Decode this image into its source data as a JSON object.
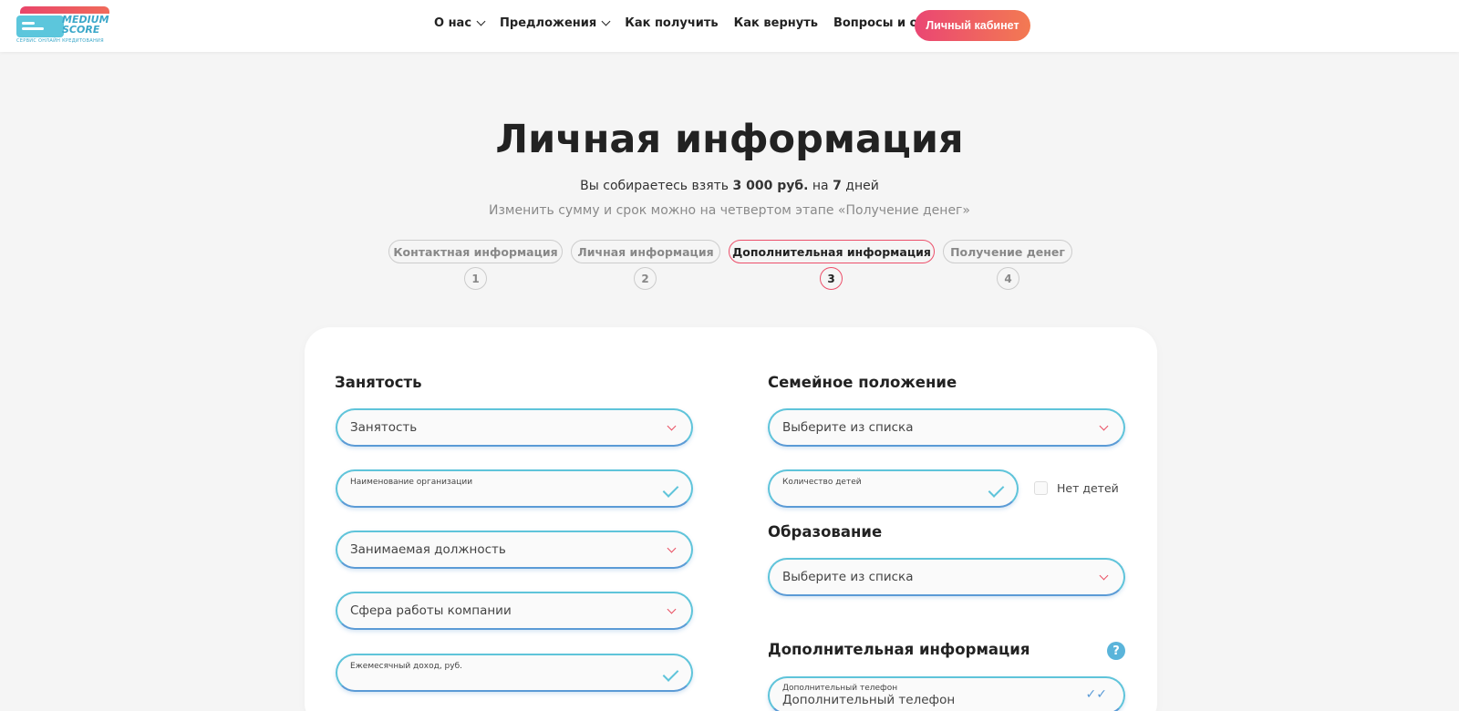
{
  "logo": {
    "line1": "MEDIUM",
    "line2": "SCORE",
    "tagline": "СЕРВИС ОНЛАЙН КРЕДИТОВАНИЯ"
  },
  "nav": {
    "about": "О нас",
    "offers": "Предложения",
    "how_get": "Как получить",
    "how_return": "Как вернуть",
    "faq": "Вопросы и ответы",
    "cabinet": "Личный кабинет"
  },
  "page": {
    "title": "Личная информация",
    "subtitle_prefix": "Вы собираетесь взять ",
    "amount": "3 000 руб.",
    "subtitle_mid": " на ",
    "days": "7",
    "subtitle_suffix": " дней",
    "hint": "Изменить сумму и срок можно на четвертом этапе «Получение денег»"
  },
  "steps": [
    {
      "label": "Контактная информация",
      "num": "1"
    },
    {
      "label": "Личная информация",
      "num": "2"
    },
    {
      "label": "Дополнительная информация",
      "num": "3"
    },
    {
      "label": "Получение денег",
      "num": "4"
    }
  ],
  "active_step": 3,
  "employment": {
    "title": "Занятость",
    "employment_select": "Занятость",
    "org_name_label": "Наименование организации",
    "position_select": "Занимаемая должность",
    "sphere_select": "Сфера работы компании",
    "income_label": "Ежемесячный доход, руб."
  },
  "family": {
    "title": "Семейное положение",
    "select": "Выберите из списка",
    "children_label": "Количество детей",
    "no_children": "Нет детей"
  },
  "education": {
    "title": "Образование",
    "select": "Выберите из списка"
  },
  "additional": {
    "title": "Дополнительная информация",
    "help": "?",
    "phone_label": "Дополнительный телефон",
    "phone_placeholder": "Дополнительный телефон"
  },
  "colors": {
    "accent_start": "#ea4673",
    "accent_end": "#f37a52",
    "field_border": "#5fc4da",
    "help": "#5ab4da"
  }
}
